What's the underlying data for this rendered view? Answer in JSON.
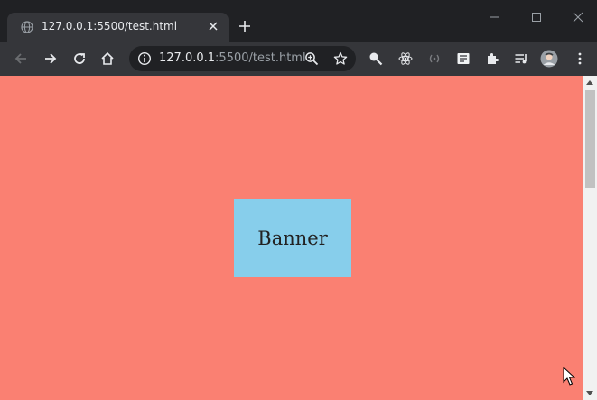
{
  "browser": {
    "tab": {
      "title": "127.0.0.1:5500/test.html"
    },
    "address_bar": {
      "host": "127.0.0.1",
      "path": ":5500/test.html"
    }
  },
  "page": {
    "banner_text": "Banner",
    "background_color": "#fa8072",
    "banner_color": "#87ceeb"
  }
}
